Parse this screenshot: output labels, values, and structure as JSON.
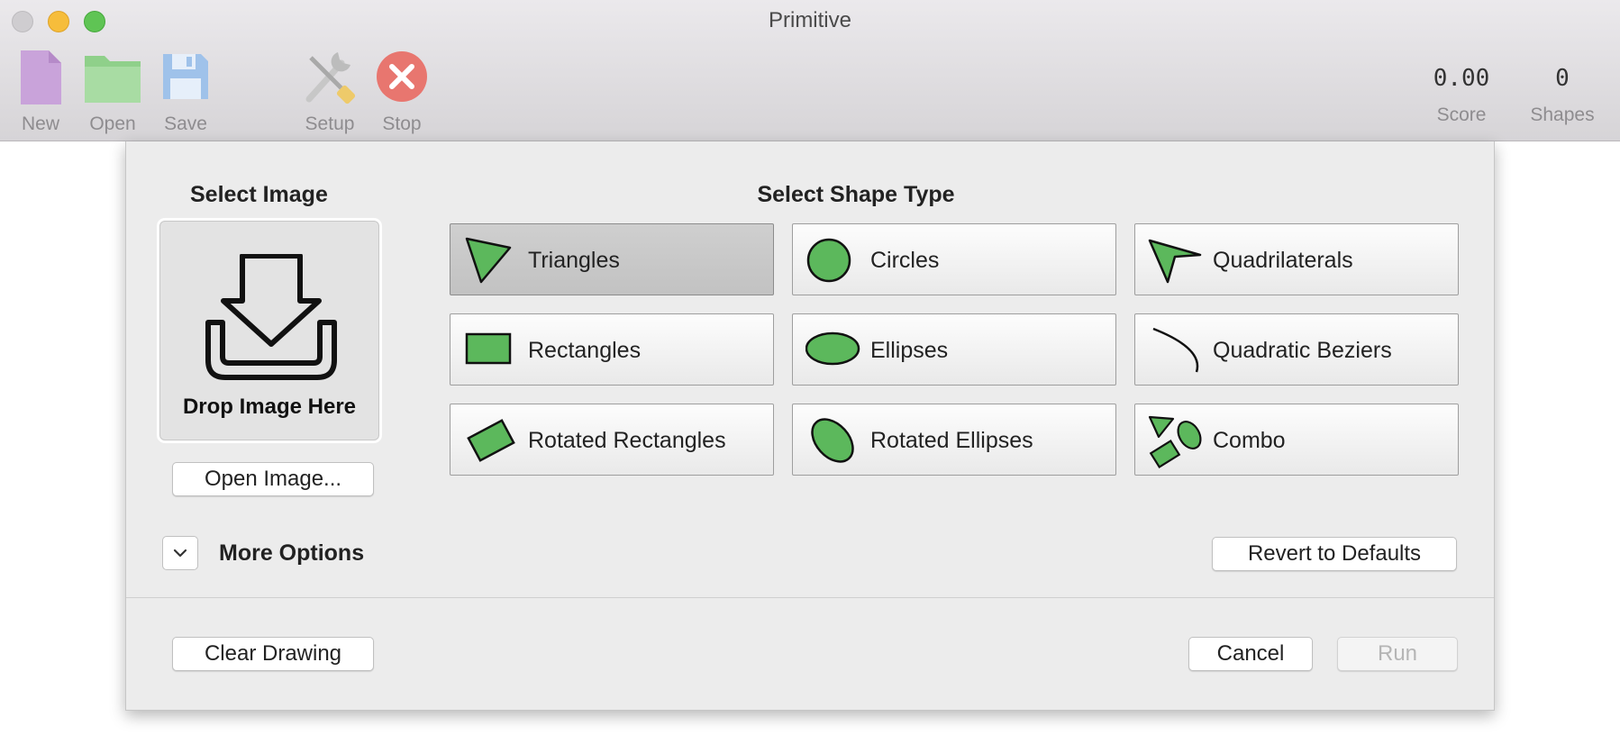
{
  "window": {
    "title": "Primitive"
  },
  "toolbar": {
    "new_label": "New",
    "open_label": "Open",
    "save_label": "Save",
    "setup_label": "Setup",
    "stop_label": "Stop",
    "score_value": "0.00",
    "score_label": "Score",
    "shapes_value": "0",
    "shapes_label": "Shapes",
    "icons": [
      "document-icon",
      "folder-icon",
      "floppy-disk-icon",
      "tools-icon",
      "stop-icon"
    ]
  },
  "sheet": {
    "select_image_title": "Select Image",
    "drop_text": "Drop Image Here",
    "open_image_label": "Open Image...",
    "select_shape_title": "Select Shape Type",
    "shapes": [
      {
        "label": "Triangles",
        "icon": "triangle-icon",
        "selected": true
      },
      {
        "label": "Circles",
        "icon": "circle-icon",
        "selected": false
      },
      {
        "label": "Quadrilaterals",
        "icon": "quadrilateral-icon",
        "selected": false
      },
      {
        "label": "Rectangles",
        "icon": "rectangle-icon",
        "selected": false
      },
      {
        "label": "Ellipses",
        "icon": "ellipse-icon",
        "selected": false
      },
      {
        "label": "Quadratic Beziers",
        "icon": "bezier-curve-icon",
        "selected": false
      },
      {
        "label": "Rotated Rectangles",
        "icon": "rotated-rectangle-icon",
        "selected": false
      },
      {
        "label": "Rotated Ellipses",
        "icon": "rotated-ellipse-icon",
        "selected": false
      },
      {
        "label": "Combo",
        "icon": "combo-shapes-icon",
        "selected": false
      }
    ],
    "more_options_label": "More Options",
    "revert_label": "Revert to Defaults",
    "clear_label": "Clear Drawing",
    "cancel_label": "Cancel",
    "run_label": "Run",
    "run_enabled": false
  },
  "colors": {
    "shape_fill": "#5cb85c",
    "shape_stroke": "#111111",
    "traffic_close": "#cfcdd0",
    "traffic_minimize": "#f6bd3b",
    "traffic_maximize": "#5fc454",
    "stop_red": "#e8766f"
  }
}
